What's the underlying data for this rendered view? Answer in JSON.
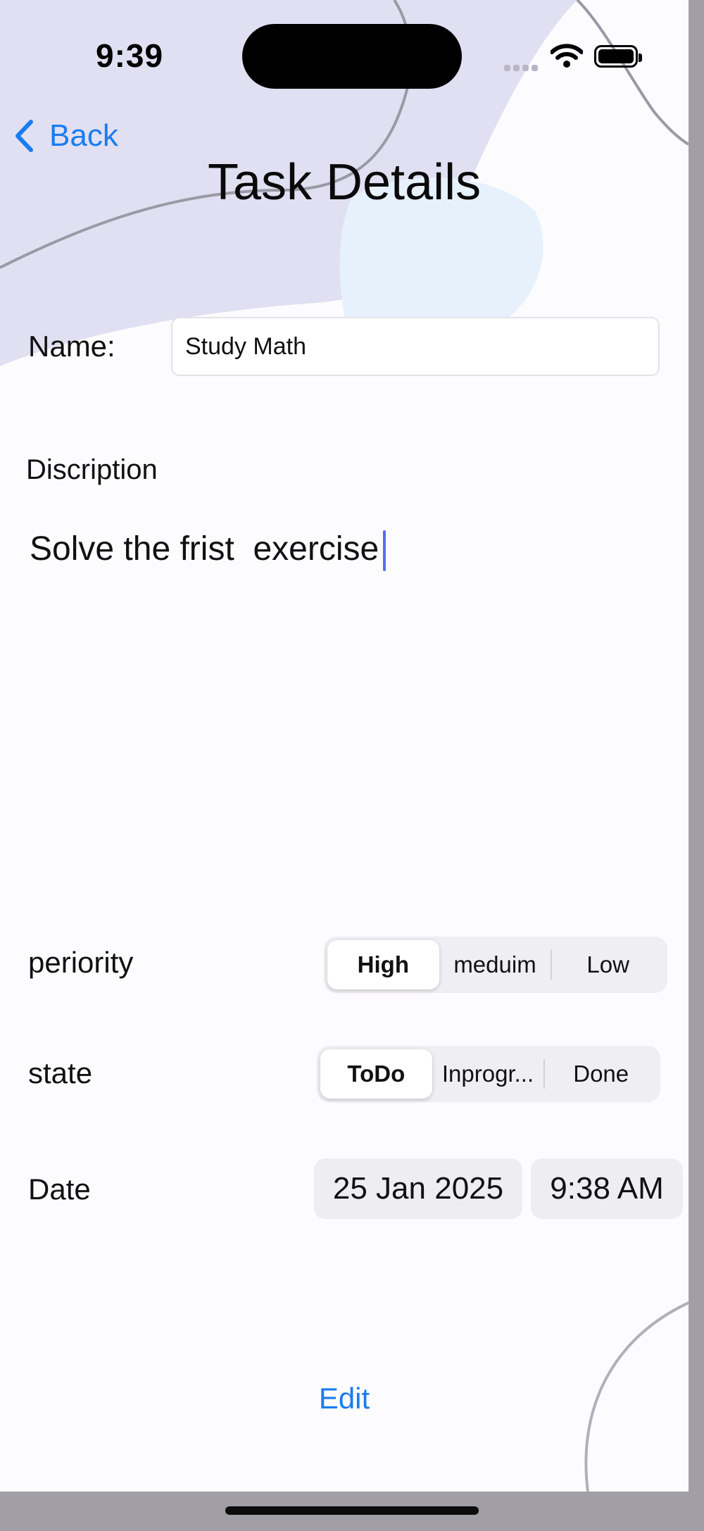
{
  "status_bar": {
    "time": "9:39"
  },
  "nav": {
    "back_label": "Back",
    "title": "Task Details"
  },
  "form": {
    "name_label": "Name:",
    "name_value": "Study Math",
    "description_label": "Discription",
    "description_value": "Solve the frist  exercise",
    "priority": {
      "label": "periority",
      "options": [
        "High",
        "meduim",
        "Low"
      ],
      "selected": "High"
    },
    "state": {
      "label": "state",
      "options": [
        "ToDo",
        "Inprogr...",
        "Done"
      ],
      "selected": "ToDo"
    },
    "date": {
      "label": "Date",
      "date_value": "25 Jan 2025",
      "time_value": "9:38 AM"
    }
  },
  "actions": {
    "edit_label": "Edit"
  },
  "colors": {
    "accent": "#1a7cf0",
    "background": "#fcfbfe",
    "segment_bg": "#efeef2"
  }
}
